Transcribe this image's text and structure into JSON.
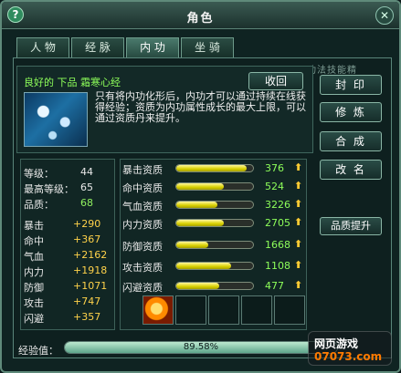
{
  "window": {
    "title": "角色"
  },
  "tabs": [
    {
      "label": "人 物"
    },
    {
      "label": "经 脉"
    },
    {
      "label": "内 功"
    },
    {
      "label": "坐 骑"
    }
  ],
  "tab_active_index": 2,
  "top_right_hint": "功法技能精",
  "skill": {
    "name": "良好的 下品 霜寒心经",
    "recycle_label": "收回",
    "description": "只有将内功化形后，内功才可以通过持续在线获得经验；资质为内功属性成长的最大上限，可以通过资质丹来提升。"
  },
  "right_buttons": [
    "封 印",
    "修 炼",
    "合 成",
    "改 名"
  ],
  "upgrade_button": "品质提升",
  "stats_basic": [
    {
      "label": "等级：",
      "value": "44"
    },
    {
      "label": "最高等级：",
      "value": "65"
    },
    {
      "label": "品质：",
      "value": "68"
    }
  ],
  "stats_attr": [
    {
      "label": "暴击",
      "value": "+290"
    },
    {
      "label": "命中",
      "value": "+367"
    },
    {
      "label": "气血",
      "value": "+2162"
    },
    {
      "label": "内力",
      "value": "+1918"
    },
    {
      "label": "防御",
      "value": "+1071"
    },
    {
      "label": "攻击",
      "value": "+747"
    },
    {
      "label": "闪避",
      "value": "+357"
    }
  ],
  "aptitudes": [
    {
      "name": "暴击资质",
      "value": "376",
      "fill": 0.92
    },
    {
      "name": "命中资质",
      "value": "524",
      "fill": 0.62
    },
    {
      "name": "气血资质",
      "value": "3226",
      "fill": 0.54
    },
    {
      "name": "内力资质",
      "value": "2705",
      "fill": 0.62
    },
    {
      "name": "防御资质",
      "value": "1668",
      "fill": 0.42
    },
    {
      "name": "攻击资质",
      "value": "1108",
      "fill": 0.72
    },
    {
      "name": "闪避资质",
      "value": "477",
      "fill": 0.56
    }
  ],
  "experience": {
    "label": "经验值：",
    "text": "89.58%",
    "fill": 0.8958
  },
  "watermark": {
    "line1": "网页游戏",
    "line2": "07073.com"
  },
  "icons": {
    "help": "help-icon",
    "close": "close-icon",
    "arrow": "up-arrow-icon"
  }
}
